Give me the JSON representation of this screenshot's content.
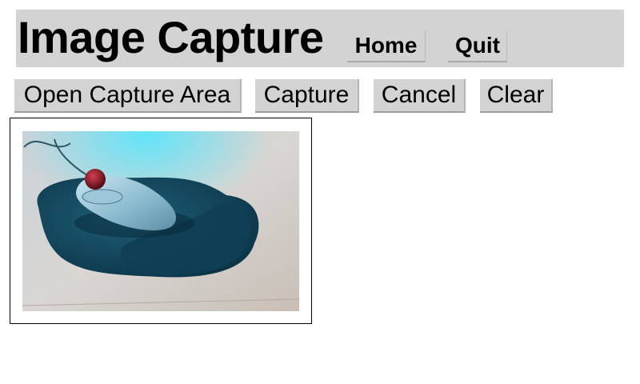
{
  "header": {
    "title": "Image Capture",
    "home_label": "Home",
    "quit_label": "Quit"
  },
  "toolbar": {
    "open_label": "Open Capture Area",
    "capture_label": "Capture",
    "cancel_label": "Cancel",
    "clear_label": "Clear"
  },
  "colors": {
    "header_bg": "#d3d3d3",
    "button_bg": "#d3d3d3"
  }
}
